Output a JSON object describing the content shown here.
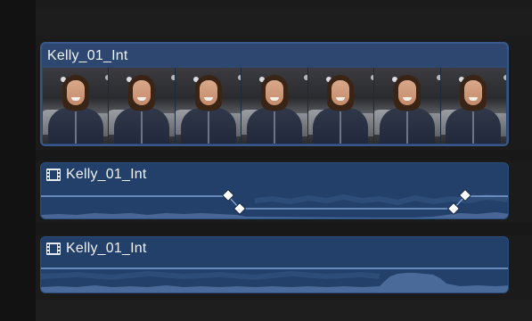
{
  "timeline": {
    "video_clip": {
      "title": "Kelly_01_Int",
      "filmstrip_frames": 7
    },
    "audio_clips": [
      {
        "title": "Kelly_01_Int",
        "icon": "filmstrip-icon",
        "keyframes": 4
      },
      {
        "title": "Kelly_01_Int",
        "icon": "filmstrip-icon",
        "keyframes": 0
      }
    ]
  },
  "colors": {
    "background": "#141414",
    "video_clip": "#2d4770",
    "audio_clip": "#22406a",
    "waveform": "#4f6f9e",
    "volume_line": "#8fb2e3",
    "keyframe": "#ffffff"
  }
}
